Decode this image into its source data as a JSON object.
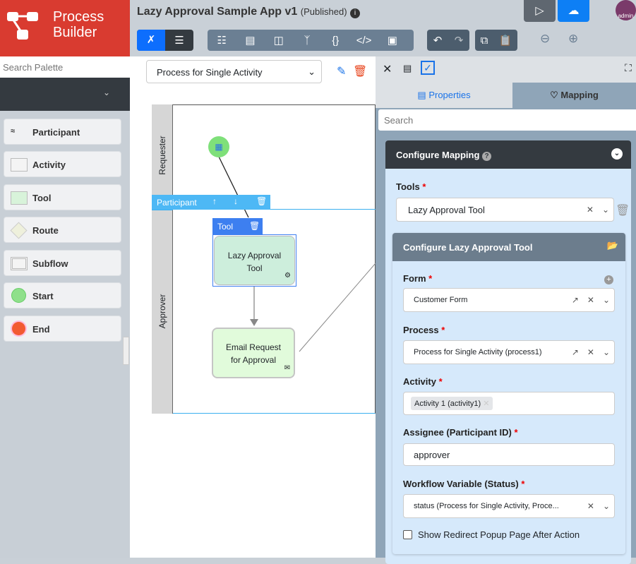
{
  "logo": {
    "line1": "Process",
    "line2": "Builder"
  },
  "palette": {
    "search_placeholder": "Search Palette",
    "items": [
      "Participant",
      "Activity",
      "Tool",
      "Route",
      "Subflow",
      "Start",
      "End"
    ]
  },
  "header": {
    "title": "Lazy Approval Sample App v1",
    "status": "(Published)",
    "avatar": "admin"
  },
  "canvas": {
    "process_select": "Process for Single Activity",
    "lanes": [
      "Requester",
      "Approver"
    ],
    "participant_toolbar": "Participant",
    "tool_toolbar": "Tool",
    "nodes": [
      "Lazy Approval Tool",
      "Email Request for Approval"
    ]
  },
  "panel": {
    "tabs": [
      "Properties",
      "Mapping"
    ],
    "search_placeholder": "Search",
    "mapping_title": "Configure Mapping",
    "tools_label": "Tools",
    "tools_value": "Lazy Approval Tool",
    "tool_title": "Configure Lazy Approval Tool",
    "form_label": "Form",
    "form_value": "Customer Form",
    "process_label": "Process",
    "process_value": "Process for Single Activity (process1)",
    "activity_label": "Activity",
    "activity_value": "Activity 1 (activity1)",
    "assignee_label": "Assignee (Participant ID)",
    "assignee_value": "approver",
    "wfvar_label": "Workflow Variable (Status)",
    "wfvar_value": "status (Process for Single Activity, Proce...",
    "redirect_label": "Show Redirect Popup Page After Action"
  },
  "colors": {
    "brand": "#d93b30",
    "primary": "#0d6efd"
  }
}
